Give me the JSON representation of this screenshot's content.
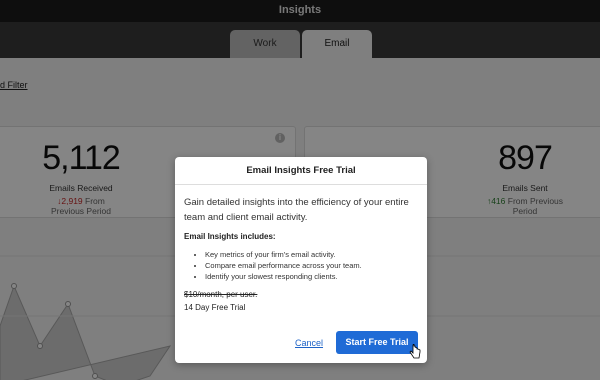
{
  "window": {
    "title": "Insights"
  },
  "tabs": [
    {
      "label": "Work"
    },
    {
      "label": "Email"
    }
  ],
  "filter": {
    "label": "d Filter"
  },
  "stats": {
    "received": {
      "value": "5,112",
      "label": "Emails Received",
      "change": "2,919",
      "change_suffix": "From Previous Period",
      "direction": "down",
      "arrow": "↓"
    },
    "sent": {
      "value": "897",
      "label": "Emails Sent",
      "change": "416",
      "change_suffix": "From Previous Period",
      "direction": "up",
      "arrow": "↑"
    }
  },
  "modal": {
    "title": "Email Insights Free Trial",
    "intro": "Gain detailed insights into the efficiency of your entire team and client email activity.",
    "includes_title": "Email Insights includes:",
    "features": [
      "Key metrics of your firm's email activity.",
      "Compare email performance across your team.",
      "Identify your slowest responding clients."
    ],
    "price": "$10/month, per user.",
    "trial_length": "14 Day Free Trial",
    "cancel_label": "Cancel",
    "start_label": "Start Free Trial"
  },
  "colors": {
    "accent": "#1f6bd6",
    "down": "#c62828",
    "up": "#2e7d32"
  }
}
